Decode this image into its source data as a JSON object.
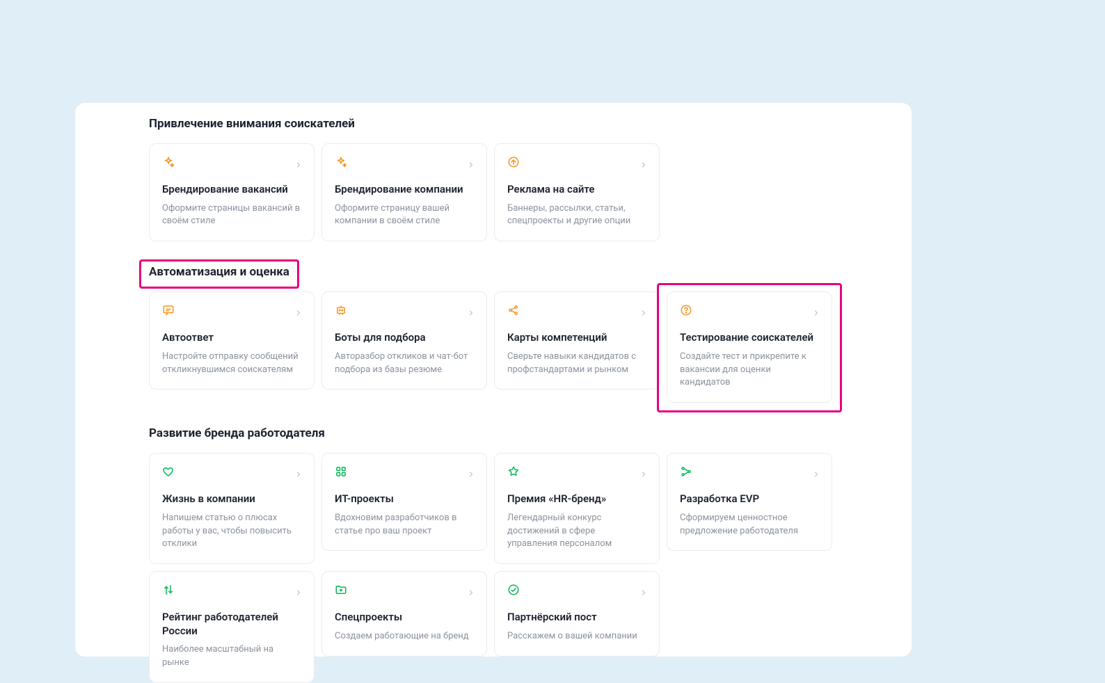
{
  "sections": [
    {
      "id": "attract",
      "heading": "Привлечение внимания соискателей",
      "heading_highlight": false,
      "cards": [
        {
          "icon": "sparkle",
          "color": "orange",
          "title": "Брендирование вакансий",
          "desc": "Оформите страницы вакансий в своём стиле",
          "highlight": false
        },
        {
          "icon": "sparkle",
          "color": "orange",
          "title": "Брендирование компании",
          "desc": "Оформите страницу вашей компании в своём стиле",
          "highlight": false
        },
        {
          "icon": "arrow-up-circle",
          "color": "orange",
          "title": "Реклама на сайте",
          "desc": "Баннеры, рассылки, статьи, спецпроекты и другие опции",
          "highlight": false
        }
      ]
    },
    {
      "id": "automation",
      "heading": "Автоматизация и оценка",
      "heading_highlight": true,
      "cards": [
        {
          "icon": "chat",
          "color": "orange",
          "title": "Автоответ",
          "desc": "Настройте отправку сообщений откликнувшимся соискателям",
          "highlight": false
        },
        {
          "icon": "bot",
          "color": "orange",
          "title": "Боты для подбора",
          "desc": "Авторазбор откликов и чат-бот подбора из базы резюме",
          "highlight": false
        },
        {
          "icon": "share",
          "color": "orange",
          "title": "Карты компетенций",
          "desc": "Сверьте навыки кандидатов с профстандартами и рынком",
          "highlight": false
        },
        {
          "icon": "question-circle",
          "color": "orange",
          "title": "Тестирование соискателей",
          "desc": "Создайте тест и прикрепите к вакансии для оценки кандидатов",
          "highlight": true
        }
      ]
    },
    {
      "id": "branding",
      "heading": "Развитие бренда работодателя",
      "heading_highlight": false,
      "cards": [
        {
          "icon": "heart",
          "color": "green",
          "title": "Жизнь в компании",
          "desc": "Напишем статью о плюсах работы у вас, чтобы повысить отклики",
          "highlight": false
        },
        {
          "icon": "grid",
          "color": "green",
          "title": "ИТ-проекты",
          "desc": "Вдохновим разработчиков в статье про ваш проект",
          "highlight": false
        },
        {
          "icon": "star",
          "color": "green",
          "title": "Премия «HR-бренд»",
          "desc": "Легендарный конкурс достижений в сфере управления персоналом",
          "highlight": false
        },
        {
          "icon": "network",
          "color": "green",
          "title": "Разработка EVP",
          "desc": "Сформируем ценностное предложение работодателя",
          "highlight": false
        },
        {
          "icon": "arrows-updown",
          "color": "green",
          "title": "Рейтинг работодателей России",
          "desc": "Наиболее масштабный на рынке",
          "highlight": false
        },
        {
          "icon": "folder-heart",
          "color": "green",
          "title": "Спецпроекты",
          "desc": "Создаем работающие на бренд",
          "highlight": false
        },
        {
          "icon": "check-circle",
          "color": "green",
          "title": "Партнёрский пост",
          "desc": "Расскажем о вашей компании",
          "highlight": false
        }
      ]
    }
  ],
  "colors": {
    "orange": "#f6941e",
    "green": "#00b857",
    "magenta": "#e6007e"
  }
}
